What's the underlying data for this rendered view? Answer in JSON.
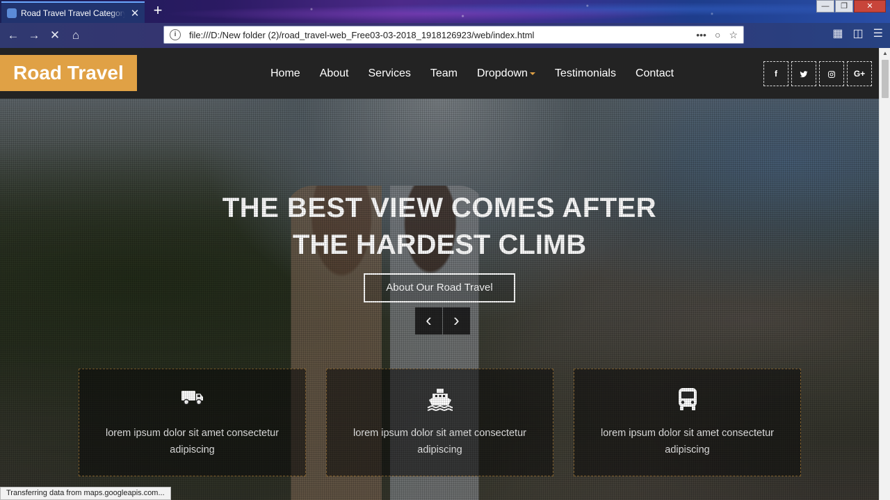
{
  "browser": {
    "tab_title": "Road Travel Travel Category Flat Bootstrap Responsive Web Template",
    "tab_close": "✕",
    "new_tab": "+",
    "url": "file:///D:/New folder (2)/road_travel-web_Free03-03-2018_1918126923/web/index.html",
    "status_text": "Transferring data from maps.googleapis.com..."
  },
  "site": {
    "logo": "Road Travel",
    "menu": [
      "Home",
      "About",
      "Services",
      "Team",
      "Dropdown",
      "Testimonials",
      "Contact"
    ],
    "social": [
      "f",
      "t",
      "ig",
      "G+"
    ]
  },
  "hero": {
    "title_line1": "THE BEST VIEW COMES AFTER",
    "title_line2": "THE HARDEST CLIMB",
    "cta": "About Our Road Travel",
    "prev": "‹",
    "next": "›"
  },
  "features": [
    {
      "icon": "truck-icon",
      "text": "lorem ipsum dolor sit amet consectetur adipiscing"
    },
    {
      "icon": "ship-icon",
      "text": "lorem ipsum dolor sit amet consectetur adipiscing"
    },
    {
      "icon": "bus-icon",
      "text": "lorem ipsum dolor sit amet consectetur adipiscing"
    }
  ],
  "colors": {
    "accent": "#e0a145",
    "header_bg": "#232323"
  }
}
